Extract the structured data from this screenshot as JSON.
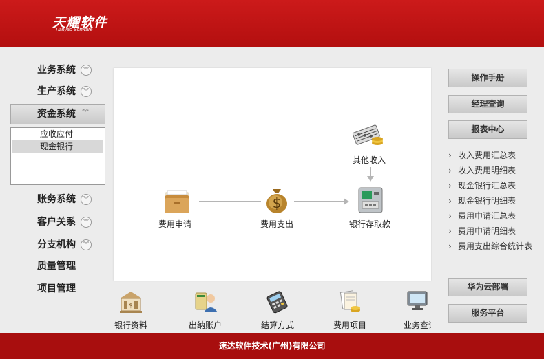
{
  "header": {
    "logo_main": "天耀软件",
    "logo_sub": "Tianyao Software"
  },
  "sidebar": {
    "items": [
      {
        "label": "业务系统"
      },
      {
        "label": "生产系统"
      },
      {
        "label": "资金系统"
      },
      {
        "label": "账务系统"
      },
      {
        "label": "客户关系"
      },
      {
        "label": "分支机构"
      },
      {
        "label": "质量管理"
      },
      {
        "label": "项目管理"
      }
    ],
    "submenu": [
      {
        "label": "应收应付"
      },
      {
        "label": "现金银行"
      }
    ]
  },
  "flow": {
    "apply": "费用申请",
    "expense": "费用支出",
    "bank": "银行存取款",
    "other_income": "其他收入"
  },
  "right": {
    "manual": "操作手册",
    "manager_query": "经理查询",
    "report_center": "报表中心",
    "reports": [
      "收入费用汇总表",
      "收入费用明细表",
      "现金银行汇总表",
      "现金银行明细表",
      "费用申请汇总表",
      "费用申请明细表",
      "费用支出综合统计表"
    ],
    "huawei": "华为云部署",
    "service": "服务平台"
  },
  "bottom": [
    {
      "label": "银行资料"
    },
    {
      "label": "出纳账户"
    },
    {
      "label": "结算方式"
    },
    {
      "label": "费用项目"
    },
    {
      "label": "业务查询"
    }
  ],
  "footer": {
    "text": "速达软件技术(广州)有限公司"
  },
  "colors": {
    "brand_red": "#b30f0f",
    "footer_red": "#a80e0e"
  }
}
